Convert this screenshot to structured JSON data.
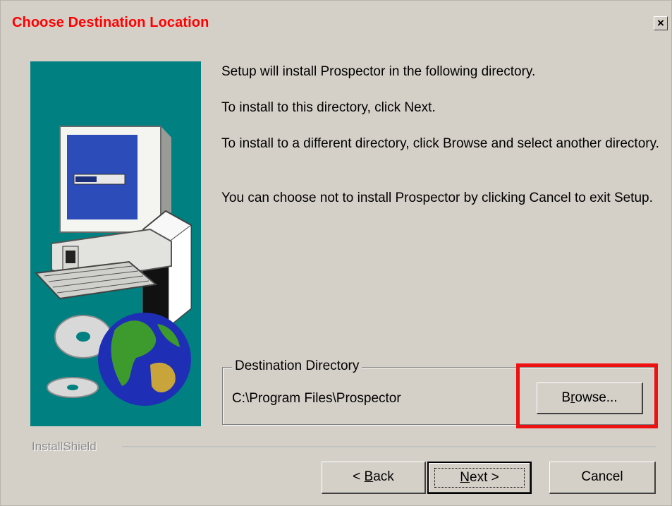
{
  "window": {
    "title": "Choose Destination Location",
    "close_label": "×"
  },
  "messages": {
    "line1": "Setup will install Prospector in the following directory.",
    "line2": "To install to this directory, click Next.",
    "line3": "To install to a different directory, click Browse and select another directory.",
    "line4": "You can choose not to install Prospector by clicking Cancel to exit Setup."
  },
  "destination": {
    "group_label": "Destination Directory",
    "path": "C:\\Program Files\\Prospector",
    "browse_pre": "B",
    "browse_mnemonic": "r",
    "browse_post": "owse..."
  },
  "footer": {
    "brand": "InstallShield",
    "back_pre": "< ",
    "back_mnemonic": "B",
    "back_post": "ack",
    "next_mnemonic": "N",
    "next_post": "ext >",
    "cancel_label": "Cancel"
  },
  "colors": {
    "title": "#ff0000",
    "dialog_bg": "#d4d0c8",
    "art_bg": "#008080",
    "highlight": "#ee1111"
  },
  "icons": {
    "close": "close-icon",
    "art": "computer-setup-illustration"
  }
}
